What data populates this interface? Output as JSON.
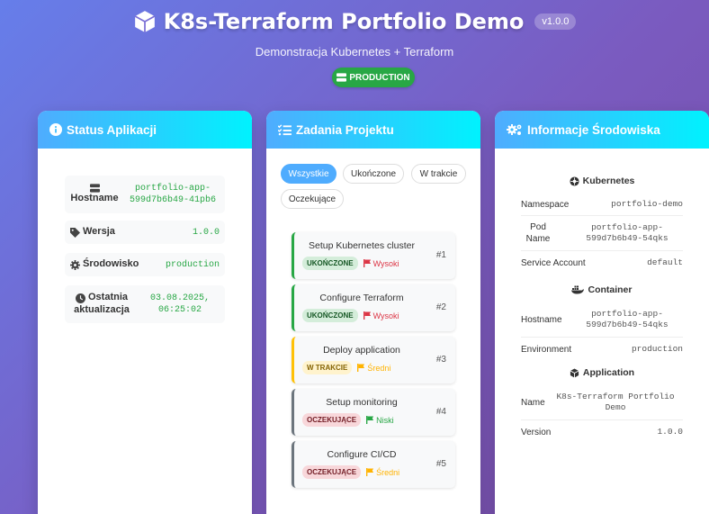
{
  "header": {
    "title": "K8s-Terraform Portfolio Demo",
    "version": "v1.0.0",
    "subtitle": "Demonstracja Kubernetes + Terraform",
    "environment": "PRODUCTION"
  },
  "status": {
    "title": "Status Aplikacji",
    "items": [
      {
        "label": "Hostname",
        "value": "portfolio-app-599d7b6b49-41pb6",
        "icon": "server-icon"
      },
      {
        "label": "Wersja",
        "value": "1.0.0",
        "icon": "tag-icon"
      },
      {
        "label": "Środowisko",
        "value": "production",
        "icon": "gear-icon"
      },
      {
        "label": "Ostatnia aktualizacja",
        "value": "03.08.2025, 06:25:02",
        "icon": "clock-icon"
      }
    ]
  },
  "tasks": {
    "title": "Zadania Projektu",
    "filters": [
      "Wszystkie",
      "Ukończone",
      "W trakcie",
      "Oczekujące"
    ],
    "active_filter": "Wszystkie",
    "items": [
      {
        "title": "Setup Kubernetes cluster",
        "status": "UKOŃCZONE",
        "priority": "Wysoki",
        "number": "#1"
      },
      {
        "title": "Configure Terraform",
        "status": "UKOŃCZONE",
        "priority": "Wysoki",
        "number": "#2"
      },
      {
        "title": "Deploy application",
        "status": "W TRAKCIE",
        "priority": "Średni",
        "number": "#3"
      },
      {
        "title": "Setup monitoring",
        "status": "OCZEKUJĄCE",
        "priority": "Niski",
        "number": "#4"
      },
      {
        "title": "Configure CI/CD",
        "status": "OCZEKUJĄCE",
        "priority": "Średni",
        "number": "#5"
      }
    ]
  },
  "env": {
    "title": "Informacje Środowiska",
    "kubernetes": {
      "title": "Kubernetes",
      "namespace_label": "Namespace",
      "namespace": "portfolio-demo",
      "pod_label": "Pod Name",
      "pod": "portfolio-app-599d7b6b49-54qks",
      "sa_label": "Service Account",
      "sa": "default"
    },
    "container": {
      "title": "Container",
      "hostname_label": "Hostname",
      "hostname": "portfolio-app-599d7b6b49-54qks",
      "env_label": "Environment",
      "environment": "production"
    },
    "application": {
      "title": "Application",
      "name_label": "Name",
      "name": "K8s-Terraform Portfolio Demo",
      "version_label": "Version",
      "version": "1.0.0"
    }
  },
  "colors": {
    "gradient_start": "#667eea",
    "gradient_end": "#764ba2",
    "card_header_start": "#4facfe",
    "card_header_end": "#00f2fe",
    "success": "#28a745",
    "warning": "#ffc107",
    "danger": "#dc3545"
  }
}
